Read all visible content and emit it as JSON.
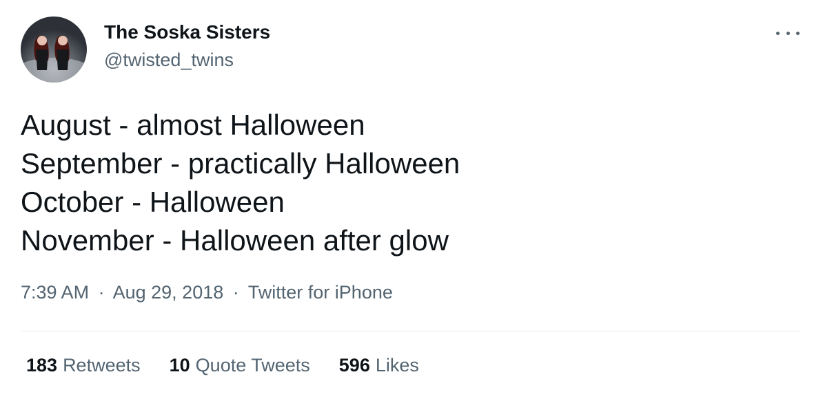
{
  "tweet": {
    "display_name": "The Soska Sisters",
    "handle": "@twisted_twins",
    "more_icon": "more-horizontal-icon",
    "body_lines": [
      "August - almost Halloween",
      "September - practically Halloween",
      "October - Halloween",
      "November - Halloween after glow"
    ],
    "time": "7:39 AM",
    "date": "Aug 29, 2018",
    "source": "Twitter for iPhone",
    "separator": "·",
    "stats": {
      "retweets": {
        "count": "183",
        "label": "Retweets"
      },
      "quotes": {
        "count": "10",
        "label": "Quote Tweets"
      },
      "likes": {
        "count": "596",
        "label": "Likes"
      }
    }
  },
  "colors": {
    "text": "#0f1419",
    "secondary": "#536471",
    "divider": "#e6ecf0"
  }
}
